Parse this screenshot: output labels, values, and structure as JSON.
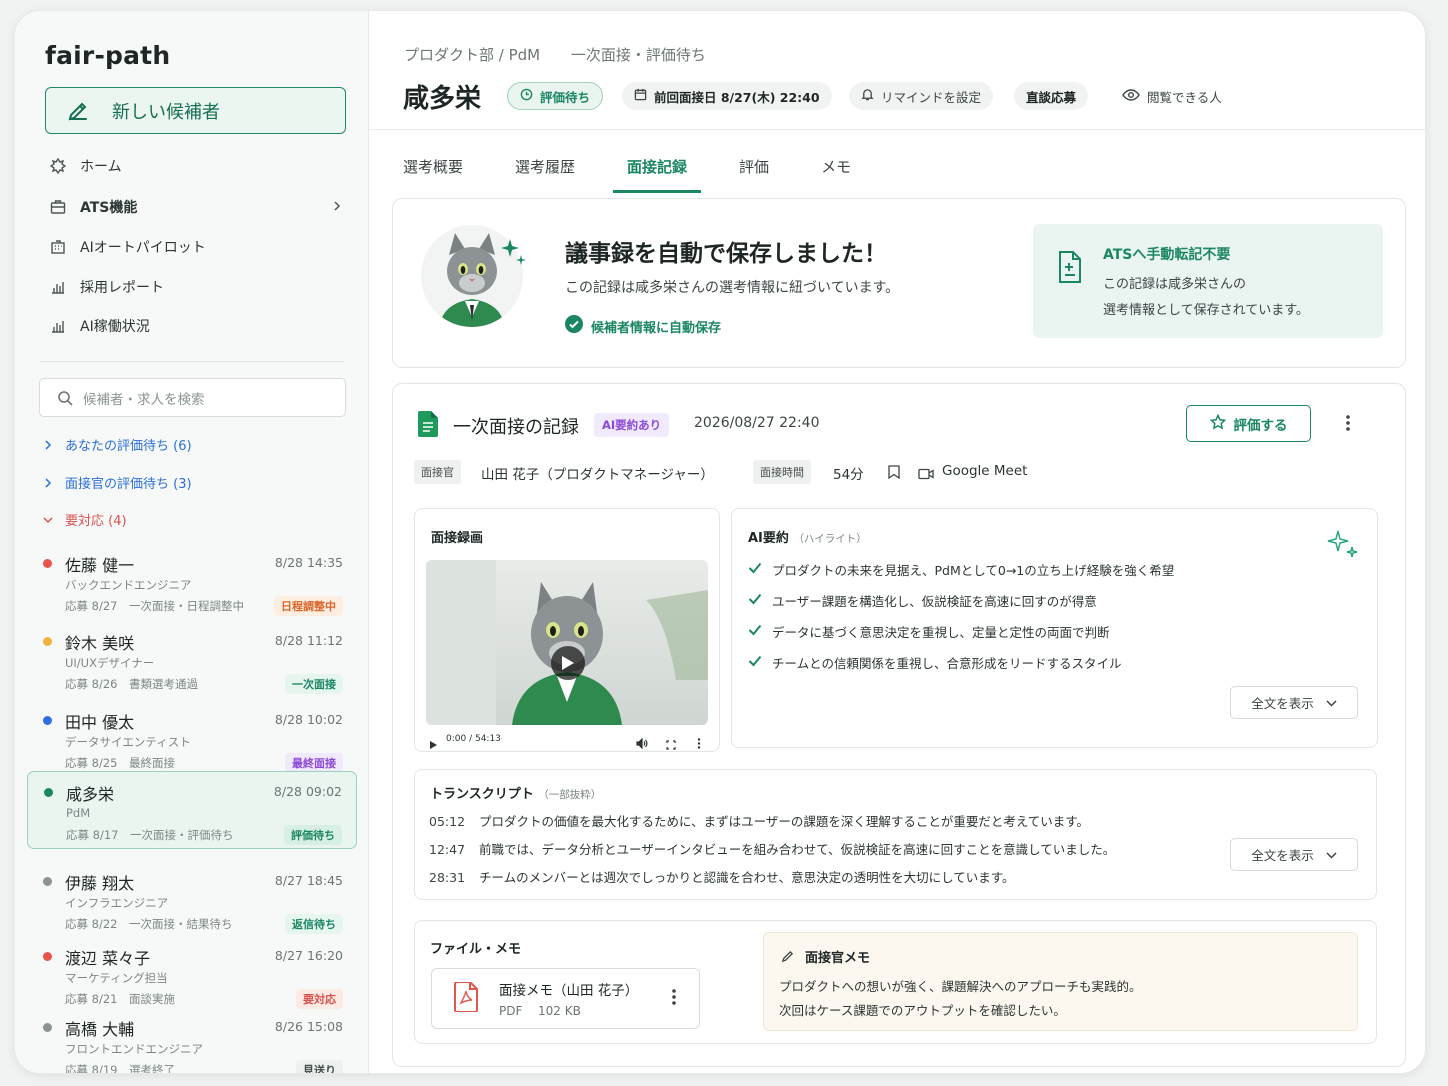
{
  "app": {
    "name": "fair-path",
    "new_candidate_label": "新しい候補者"
  },
  "nav": [
    {
      "label": "ホーム",
      "icon": "home-icon"
    },
    {
      "label": "ATS機能",
      "icon": "briefcase-icon"
    },
    {
      "label": "AIオートパイロット",
      "icon": "building-icon"
    },
    {
      "label": "採用レポート",
      "icon": "bar-chart-icon"
    },
    {
      "label": "AI稼働状況",
      "icon": "bar-chart-icon"
    }
  ],
  "search": {
    "placeholder": "候補者・求人を検索"
  },
  "groups": [
    {
      "label": "あなたの評価待ち (6)",
      "color": "#2b6fd6"
    },
    {
      "label": "面接官の評価待ち (3)",
      "color": "#2b6fd6"
    },
    {
      "label": "要対応 (4)",
      "color": "#d9534f"
    }
  ],
  "candidates": [
    {
      "name": "佐藤 健一",
      "time": "8/28 14:35",
      "role": "バックエンドエンジニア",
      "status": "応募 8/27　一次面接・日程調整中",
      "badge": "日程調整中",
      "dot": "#e8544a",
      "badge_bg": "#fdeee2",
      "badge_fg": "#d8662a"
    },
    {
      "name": "鈴木 美咲",
      "time": "8/28 11:12",
      "role": "UI/UXデザイナー",
      "status": "応募 8/26　書類選考通過",
      "badge": "一次面接",
      "dot": "#f0b43c",
      "badge_bg": "#e6f5ee",
      "badge_fg": "#1b8762"
    },
    {
      "name": "田中 優太",
      "time": "8/28 10:02",
      "role": "データサイエンティスト",
      "status": "応募 8/25　最終面接",
      "badge": "最終面接",
      "dot": "#2f6fe0",
      "badge_bg": "#f1eafc",
      "badge_fg": "#8a4ad6"
    },
    {
      "name": "咸多栄",
      "time": "8/28 09:02",
      "role": "PdM",
      "status": "応募 8/17　一次面接・評価待ち",
      "badge": "評価待ち",
      "dot": "#1b8762",
      "badge_bg": "#d8efe4",
      "badge_fg": "#1b8762"
    },
    {
      "name": "伊藤 翔太",
      "time": "8/27 18:45",
      "role": "インフラエンジニア",
      "status": "応募 8/22　一次面接・結果待ち",
      "badge": "返信待ち",
      "dot": "#8a9493",
      "badge_bg": "#e6f5ee",
      "badge_fg": "#1b8762"
    },
    {
      "name": "渡辺 菜々子",
      "time": "8/27 16:20",
      "role": "マーケティング担当",
      "status": "応募 8/21　面談実施",
      "badge": "要対応",
      "dot": "#e8544a",
      "badge_bg": "#fdeae4",
      "badge_fg": "#d9534f"
    },
    {
      "name": "高橋 大輔",
      "time": "8/26 15:08",
      "role": "フロントエンドエンジニア",
      "status": "応募 8/19　選考終了",
      "badge": "見送り",
      "dot": "#8a9493",
      "badge_bg": "#eef1f0",
      "badge_fg": "#444e4d"
    }
  ],
  "header": {
    "breadcrumb_dept": "プロダクト部 / PdM",
    "breadcrumb_stage": "一次面接・評価待ち",
    "name": "咸多栄",
    "status": "評価待ち",
    "last_interview": "前回面接日 8/27(木) 22:40",
    "remind": "リマインドを設定",
    "apply_type": "直談応募",
    "viewers": "閲覧できる人"
  },
  "tabs": [
    "選考概要",
    "選考履歴",
    "面接記録",
    "評価",
    "メモ"
  ],
  "notice": {
    "title": "議事録を自動で保存しました！",
    "desc": "この記録は咸多栄さんの選考情報に紐づいています。",
    "saved": "候補者情報に自動保存",
    "ats_title": "ATSへ手動転記不要",
    "ats_line1": "この記録は咸多栄さんの",
    "ats_line2": "選考情報として保存されています。"
  },
  "record": {
    "title": "一次面接の記録",
    "ai_tag": "AI要約あり",
    "datetime": "2026/08/27 22:40",
    "evaluate": "評価する",
    "interviewer_tag": "面接官",
    "interviewer": "山田 花子（プロダクトマネージャー）",
    "duration_tag": "面接時間",
    "duration": "54分",
    "platform": "Google Meet"
  },
  "video": {
    "label": "面接録画",
    "time": "0:00 / 54:13"
  },
  "summary": {
    "label": "AI要約",
    "sub": "（ハイライト）",
    "points": [
      "プロダクトの未来を見据え、PdMとして0→1の立ち上げ経験を強く希望",
      "ユーザー課題を構造化し、仮説検証を高速に回すのが得意",
      "データに基づく意思決定を重視し、定量と定性の両面で判断",
      "チームとの信頼関係を重視し、合意形成をリードするスタイル"
    ],
    "show_all": "全文を表示"
  },
  "transcript": {
    "label": "トランスクリプト",
    "sub": "（一部抜粋）",
    "lines": [
      {
        "t": "05:12",
        "text": "プロダクトの価値を最大化するために、まずはユーザーの課題を深く理解することが重要だと考えています。"
      },
      {
        "t": "12:47",
        "text": "前職では、データ分析とユーザーインタビューを組み合わせて、仮説検証を高速に回すことを意識していました。"
      },
      {
        "t": "28:31",
        "text": "チームのメンバーとは週次でしっかりと認識を合わせ、意思決定の透明性を大切にしています。"
      }
    ],
    "show_all": "全文を表示"
  },
  "files": {
    "label": "ファイル・メモ",
    "file_name": "面接メモ（山田 花子）",
    "file_type": "PDF",
    "file_size": "102 KB",
    "memo_title": "面接官メモ",
    "memo_line1": "プロダクトへの想いが強く、課題解決へのアプローチも実践的。",
    "memo_line2": "次回はケース課題でのアウトプットを確認したい。"
  },
  "colors": {
    "brand": "#1b8762",
    "accent_bg": "#eaf4f1",
    "memo_bg": "#fdf8ef"
  }
}
